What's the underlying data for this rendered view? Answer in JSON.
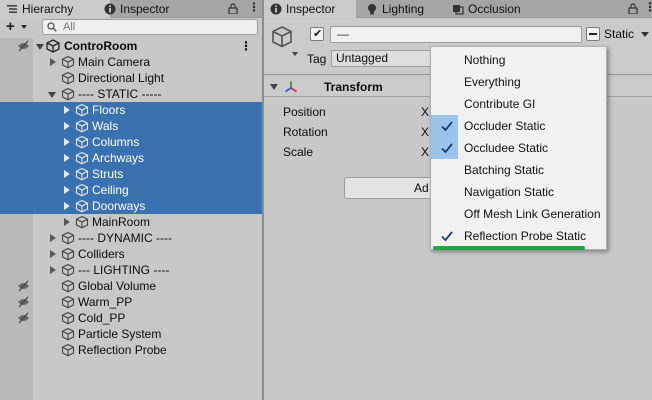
{
  "hierarchy": {
    "tab_label": "Hierarchy",
    "inspector_tab_label": "Inspector",
    "search_placeholder": "All",
    "scene_name": "ControRoom",
    "items": [
      {
        "label": "Main Camera"
      },
      {
        "label": "Directional Light"
      },
      {
        "label": "---- STATIC -----"
      },
      {
        "label": "Floors"
      },
      {
        "label": "Wals"
      },
      {
        "label": "Columns"
      },
      {
        "label": "Archways"
      },
      {
        "label": "Struts"
      },
      {
        "label": "Ceiling"
      },
      {
        "label": "Doorways"
      },
      {
        "label": "MainRoom"
      },
      {
        "label": "---- DYNAMIC ----"
      },
      {
        "label": "Colliders"
      },
      {
        "label": "--- LIGHTING ----"
      },
      {
        "label": "Global Volume"
      },
      {
        "label": "Warm_PP"
      },
      {
        "label": "Cold_PP"
      },
      {
        "label": "Particle System"
      },
      {
        "label": "Reflection Probe"
      }
    ]
  },
  "inspector": {
    "tabs": [
      {
        "label": "Inspector"
      },
      {
        "label": "Lighting"
      },
      {
        "label": "Occlusion"
      }
    ],
    "name_value": "—",
    "static_label": "Static",
    "tag_label": "Tag",
    "tag_value": "Untagged",
    "component_title": "Transform",
    "properties": [
      {
        "label": "Position",
        "axis": "X"
      },
      {
        "label": "Rotation",
        "axis": "X"
      },
      {
        "label": "Scale",
        "axis": "X"
      }
    ],
    "add_button_label": "Ad"
  },
  "static_menu": {
    "items": [
      {
        "label": "Nothing",
        "checked": false
      },
      {
        "label": "Everything",
        "checked": false
      },
      {
        "label": "Contribute GI",
        "checked": false
      },
      {
        "label": "Occluder Static",
        "checked": true
      },
      {
        "label": "Occludee Static",
        "checked": true
      },
      {
        "label": "Batching Static",
        "checked": false
      },
      {
        "label": "Navigation Static",
        "checked": false
      },
      {
        "label": "Off Mesh Link Generation",
        "checked": false
      },
      {
        "label": "Reflection Probe Static",
        "checked": true
      }
    ]
  },
  "colors": {
    "selection": "#3a72b0",
    "menu_check_highlight": "#9bc4ec",
    "annotation_underline": "#1fa844"
  }
}
